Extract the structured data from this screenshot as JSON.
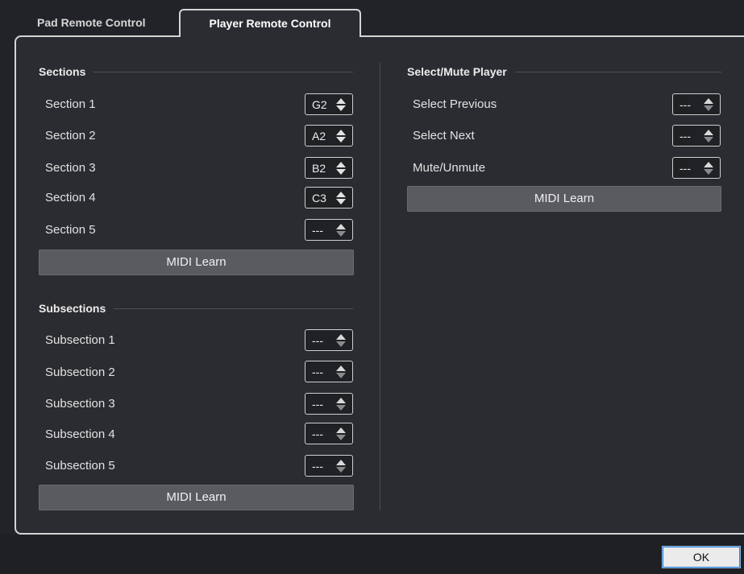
{
  "tabs": [
    {
      "label": "Pad Remote Control",
      "active": false
    },
    {
      "label": "Player Remote Control",
      "active": true
    }
  ],
  "sections": {
    "header": "Sections",
    "rows": [
      {
        "label": "Section 1",
        "value": "G2"
      },
      {
        "label": "Section 2",
        "value": "A2"
      },
      {
        "label": "Section 3",
        "value": "B2"
      },
      {
        "label": "Section 4",
        "value": "C3"
      },
      {
        "label": "Section 5",
        "value": "---"
      }
    ],
    "midi_learn": "MIDI Learn"
  },
  "subsections": {
    "header": "Subsections",
    "rows": [
      {
        "label": "Subsection 1",
        "value": "---"
      },
      {
        "label": "Subsection 2",
        "value": "---"
      },
      {
        "label": "Subsection 3",
        "value": "---"
      },
      {
        "label": "Subsection 4",
        "value": "---"
      },
      {
        "label": "Subsection 5",
        "value": "---"
      }
    ],
    "midi_learn": "MIDI Learn"
  },
  "select_mute": {
    "header": "Select/Mute Player",
    "rows": [
      {
        "label": "Select Previous",
        "value": "---"
      },
      {
        "label": "Select Next",
        "value": "---"
      },
      {
        "label": "Mute/Unmute",
        "value": "---"
      }
    ],
    "midi_learn": "MIDI Learn"
  },
  "footer": {
    "ok_label": "OK"
  }
}
